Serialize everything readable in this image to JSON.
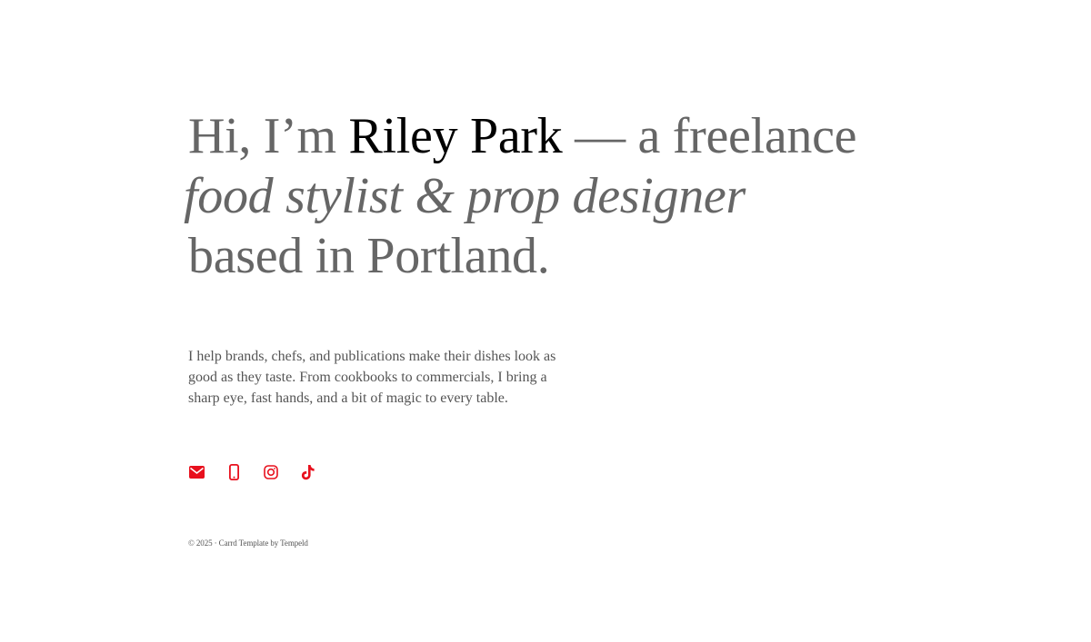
{
  "hero": {
    "intro": "Hi, I’m ",
    "name": "Riley Park",
    "after_name": " — a freelance",
    "role": "food stylist & prop designer",
    "location": "based in Portland."
  },
  "bio": "I help brands, chefs, and publications make their dishes look as good as they taste. From cookbooks to commercials, I bring a sharp eye, fast hands, and a bit of magic to every table.",
  "social": {
    "accent_color": "#e8101d",
    "icons": [
      "email-icon",
      "mobile-phone-icon",
      "instagram-icon",
      "tiktok-icon"
    ]
  },
  "footer": {
    "text": "© 2025 · Carrd Template by Tempeld"
  },
  "colors": {
    "background": "#ffffff",
    "headline_text": "#666666",
    "name_text": "#000000",
    "body_text": "#555555"
  }
}
